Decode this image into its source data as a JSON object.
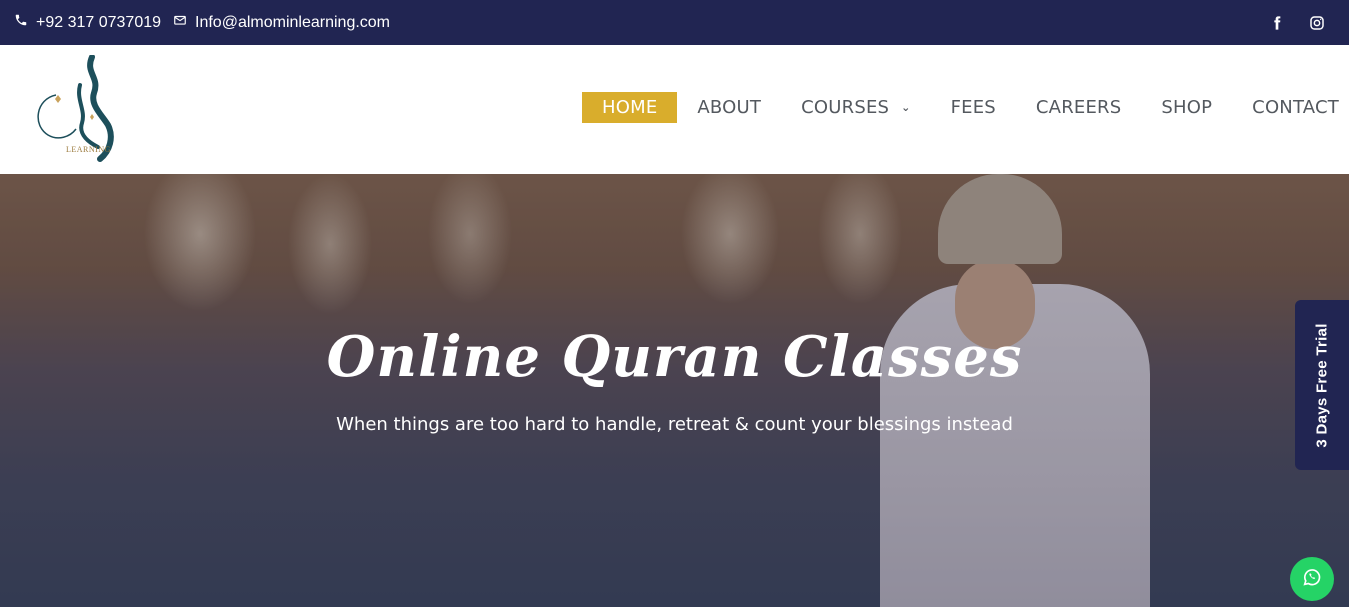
{
  "topbar": {
    "phone": "+92 317 0737019",
    "email": "Info@almominlearning.com",
    "icons": [
      "phone-icon",
      "envelope-icon",
      "facebook-icon",
      "instagram-icon"
    ]
  },
  "header": {
    "logo_text": "LEARNING",
    "nav": [
      {
        "label": "HOME",
        "active": true
      },
      {
        "label": "ABOUT"
      },
      {
        "label": "COURSES",
        "has_dropdown": true
      },
      {
        "label": "FEES"
      },
      {
        "label": "CAREERS"
      },
      {
        "label": "SHOP"
      },
      {
        "label": "CONTACT"
      }
    ]
  },
  "hero": {
    "title": "Online Quran Classes",
    "subtitle": "When things are too hard to handle, retreat & count your blessings instead"
  },
  "trial_tab": {
    "label": "3 Days Free Trial"
  },
  "colors": {
    "topbar_bg": "#212552",
    "accent_gold": "#d9ad2c",
    "nav_text": "#54595f",
    "whatsapp_green": "#25d366"
  }
}
